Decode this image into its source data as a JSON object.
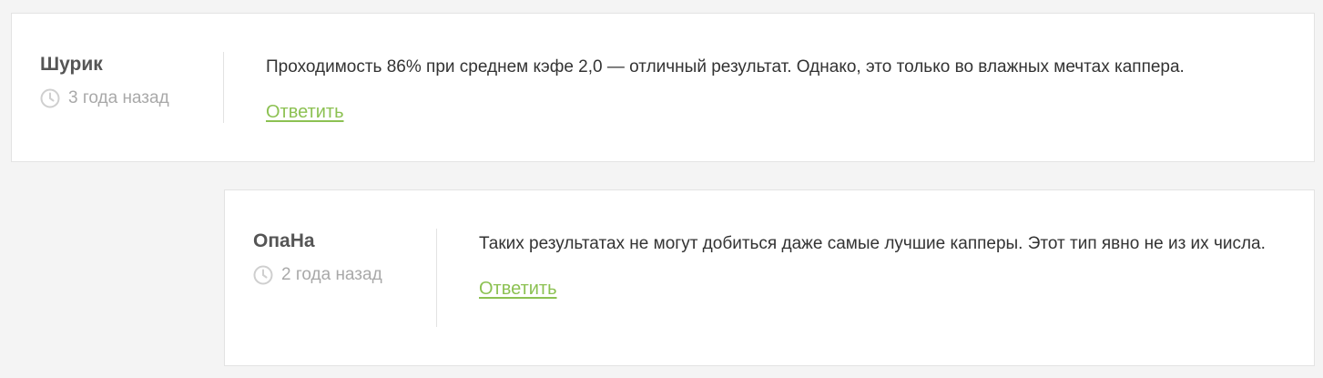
{
  "comments": [
    {
      "author": "Шурик",
      "time": "3 года назад",
      "text": "Проходимость 86% при среднем кэфе 2,0 — отличный результат. Однако, это только во влажных мечтах каппера.",
      "reply_label": "Ответить"
    },
    {
      "author": "ОпаНа",
      "time": "2 года назад",
      "text": "Таких результатах не могут добиться даже самые лучшие капперы. Этот тип явно не из их числа.",
      "reply_label": "Ответить"
    }
  ],
  "icons": {
    "time": "clock-icon"
  },
  "colors": {
    "accent": "#8cc152",
    "muted": "#a9a9a9",
    "author": "#555555"
  }
}
